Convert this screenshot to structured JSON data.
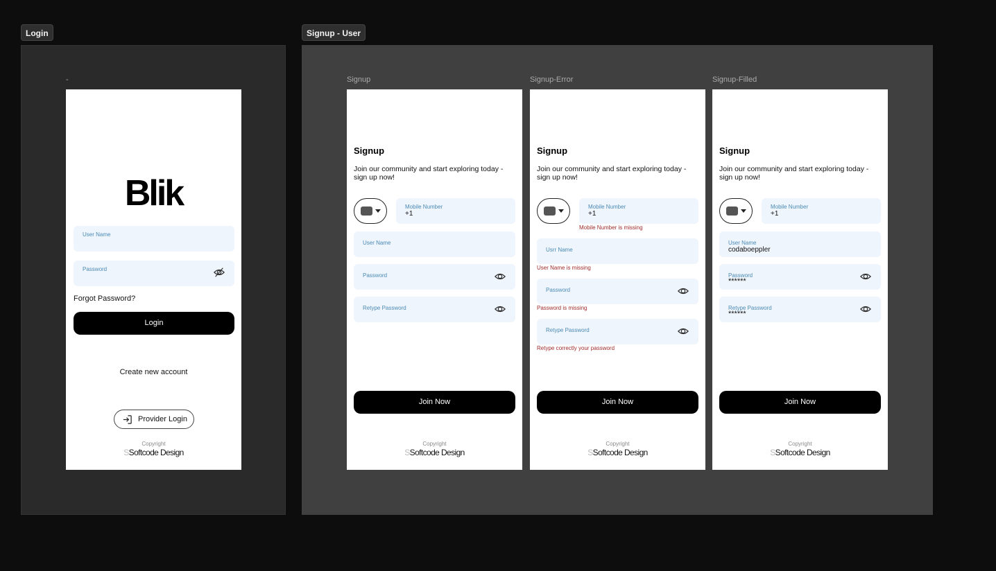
{
  "sections": {
    "login_tag": "Login",
    "signup_tag": "Signup - User"
  },
  "login_frame": {
    "frame_label": "-",
    "logo": "Blik",
    "username_label": "User Name",
    "password_label": "Password",
    "forgot_password": "Forgot Password?",
    "login_button": "Login",
    "create_account": "Create new account",
    "provider_login": "Provider Login",
    "copyright_label": "Copyright",
    "brand_mark": "S",
    "brand": "Softcode Design"
  },
  "signup": {
    "frame_label": "Signup",
    "title": "Signup",
    "subtitle": "Join our community and start exploring today - sign up now!",
    "mobile_label": "Mobile Number",
    "mobile_value": "+1",
    "username_label": "User Name",
    "password_label": "Password",
    "retype_label": "Retype Password",
    "join_button": "Join Now",
    "copyright_label": "Copyright",
    "brand_mark": "S",
    "brand": "Softcode Design"
  },
  "signup_error": {
    "frame_label": "Signup-Error",
    "title": "Signup",
    "subtitle": "Join our community and start exploring today - sign up now!",
    "mobile_label": "Mobile Number",
    "mobile_value": "+1",
    "mobile_error": "Mobile Number is missing",
    "username_label": "Usrr Name",
    "username_error": "User Name is missing",
    "password_label": "Password",
    "password_error": "Password is missing",
    "retype_label": "Retype Password",
    "retype_error": "Retype correctly your password",
    "join_button": "Join Now",
    "copyright_label": "Copyright",
    "brand_mark": "S",
    "brand": "Softcode Design"
  },
  "signup_filled": {
    "frame_label": "Signup-Filled",
    "title": "Signup",
    "subtitle": "Join our community and start exploring today - sign up now!",
    "mobile_label": "Mobile Number",
    "mobile_value": "+1",
    "username_label": "User Name",
    "username_value": "codaboeppler",
    "password_label": "Password",
    "password_value": "******",
    "retype_label": "Retype Password",
    "retype_value": "******",
    "join_button": "Join Now",
    "copyright_label": "Copyright",
    "brand_mark": "S",
    "brand": "Softcode Design"
  },
  "colors": {
    "field_bg": "#eff5fc",
    "field_label": "#4a8ab5",
    "error": "#9e2a2a",
    "button": "#000000"
  },
  "icons": [
    "eye-off-icon",
    "eye-icon",
    "login-arrow-icon",
    "flag-icon",
    "caret-down-icon"
  ]
}
